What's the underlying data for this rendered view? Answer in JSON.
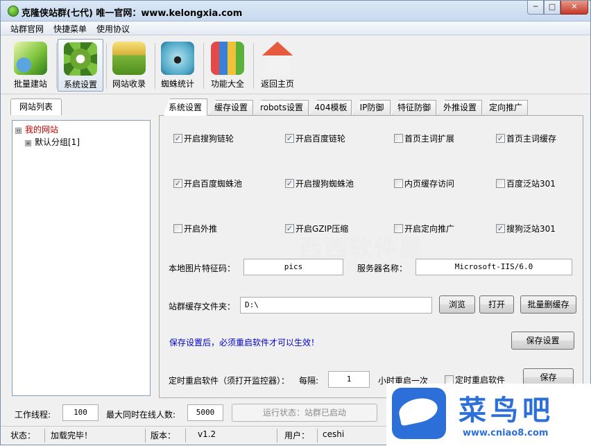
{
  "window": {
    "title": "克隆侠站群(七代)  唯一官网：www.kelongxia.com",
    "min": "─",
    "max": "□",
    "close": "✕"
  },
  "menu": [
    "站群官网",
    "快捷菜单",
    "使用协议"
  ],
  "toolbar": [
    {
      "label": "批量建站",
      "icon": "leaf-globe-icon"
    },
    {
      "label": "系统设置",
      "icon": "gear-icon"
    },
    {
      "label": "网站收录",
      "icon": "folder-icon"
    },
    {
      "label": "蜘蛛统计",
      "icon": "spider-icon"
    },
    {
      "label": "功能大全",
      "icon": "books-icon"
    },
    {
      "label": "返回主页",
      "icon": "home-icon"
    }
  ],
  "left": {
    "tab": "网站列表",
    "tree": {
      "root": "我的网站",
      "root_toggle": "⊟",
      "child": "默认分组[1]",
      "child_toggle": "⊞"
    }
  },
  "tabs": [
    "系统设置",
    "缓存设置",
    "robots设置",
    "404模板",
    "IP防御",
    "特征防御",
    "外推设置",
    "定向推广"
  ],
  "settings": {
    "checkboxes": [
      {
        "label": "开启搜狗链轮",
        "checked": true
      },
      {
        "label": "开启百度链轮",
        "checked": true
      },
      {
        "label": "首页主词扩展",
        "checked": false
      },
      {
        "label": "首页主词缓存",
        "checked": true
      },
      {
        "label": "开启百度蜘蛛池",
        "checked": true
      },
      {
        "label": "开启搜狗蜘蛛池",
        "checked": true
      },
      {
        "label": "内页缓存访问",
        "checked": false
      },
      {
        "label": "百度泛站301",
        "checked": false
      },
      {
        "label": "开启外推",
        "checked": false
      },
      {
        "label": "开启GZIP压缩",
        "checked": true
      },
      {
        "label": "开启定向推广",
        "checked": false
      },
      {
        "label": "搜狗泛站301",
        "checked": true
      }
    ],
    "image_code_label": "本地图片特征码：",
    "image_code_value": "pics",
    "server_label": "服务器名称：",
    "server_value": "Microsoft-IIS/6.0",
    "cache_folder_label": "站群缓存文件夹：",
    "cache_folder_value": "D:\\",
    "browse": "浏览",
    "open": "打开",
    "bulk_delete": "批量删缓存",
    "notice": "保存设置后，必须重启软件才可以生效！",
    "save_settings": "保存设置",
    "restart_label": "定时重启软件（须打开监控器）：",
    "interval_label": "每隔:",
    "interval_value": "1",
    "interval_unit": "小时重启一次",
    "restart_checkbox": "定时重启软件",
    "save": "保存"
  },
  "bottom": {
    "threads_label": "工作线程:",
    "threads_value": "100",
    "max_online_label": "最大同时在线人数:",
    "max_online_value": "5000",
    "run_state": "运行状态：站群已启动"
  },
  "status": {
    "state_label": "状态：",
    "state_value": "加载完毕！",
    "version_label": "版本：",
    "version_value": "v1.2",
    "user_label": "用户：",
    "user_value": "ceshi"
  },
  "watermark": "西西软件屋",
  "brand": {
    "name": "菜鸟吧",
    "url": "www.cniao8.com"
  }
}
